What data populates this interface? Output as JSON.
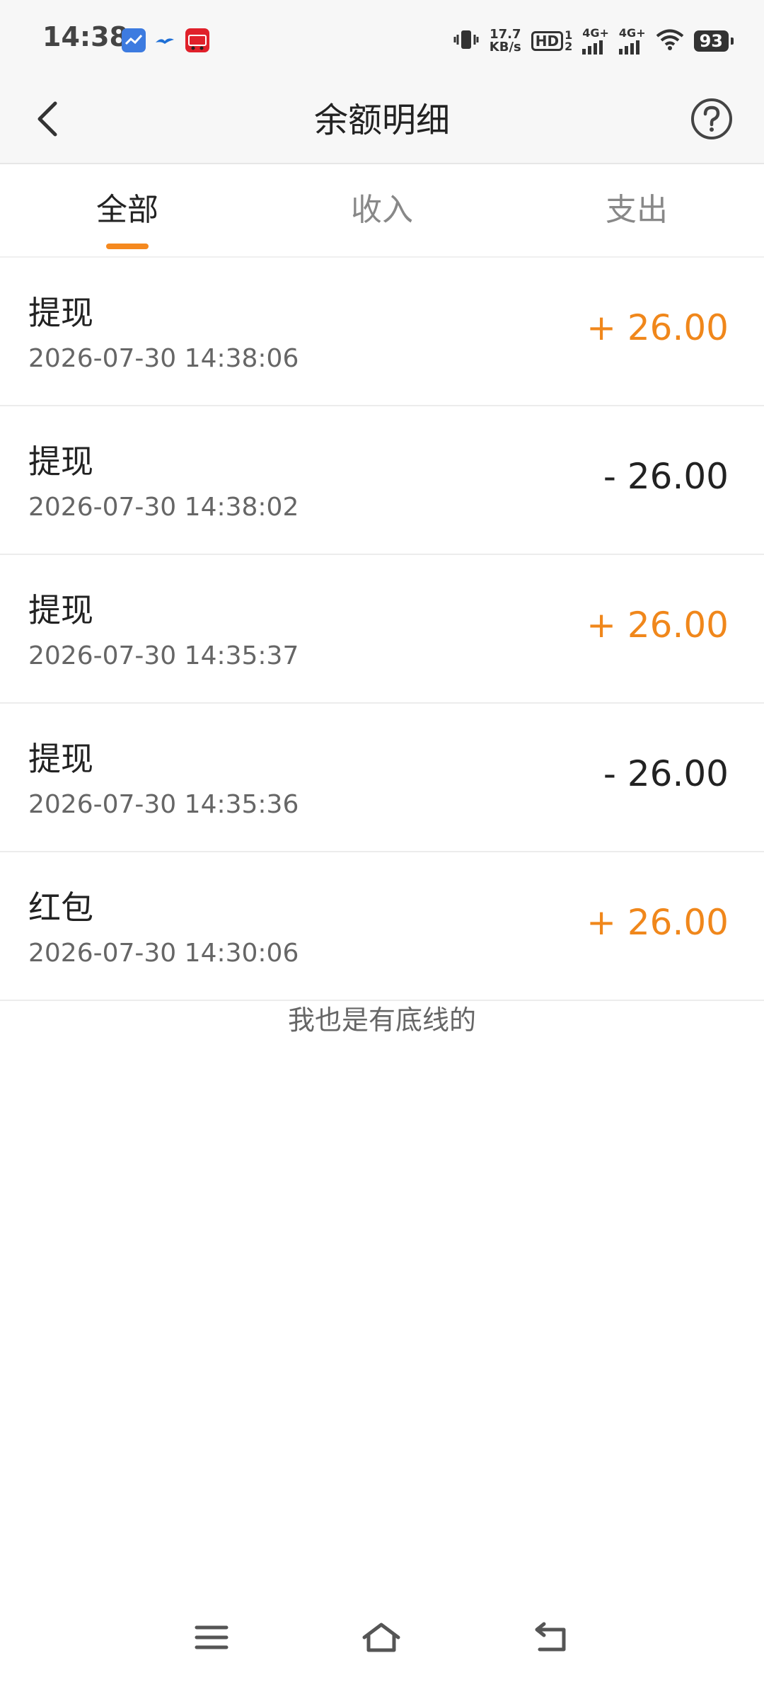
{
  "status_bar": {
    "time": "14:38",
    "net_speed_value": "17.7",
    "net_speed_unit": "KB/s",
    "hd_label": "HD",
    "sim1": "1",
    "sim2": "2",
    "network_1": "4G+",
    "network_2": "4G+",
    "battery": "93"
  },
  "header": {
    "title": "余额明细"
  },
  "tabs": [
    {
      "label": "全部",
      "active": true
    },
    {
      "label": "收入",
      "active": false
    },
    {
      "label": "支出",
      "active": false
    }
  ],
  "transactions": [
    {
      "title": "提现",
      "time": "2026-07-30 14:38:06",
      "amount": "+ 26.00",
      "type": "income"
    },
    {
      "title": "提现",
      "time": "2026-07-30 14:38:02",
      "amount": "- 26.00",
      "type": "expense"
    },
    {
      "title": "提现",
      "time": "2026-07-30 14:35:37",
      "amount": "+ 26.00",
      "type": "income"
    },
    {
      "title": "提现",
      "time": "2026-07-30 14:35:36",
      "amount": "- 26.00",
      "type": "expense"
    },
    {
      "title": "红包",
      "time": "2026-07-30 14:30:06",
      "amount": "+ 26.00",
      "type": "income"
    }
  ],
  "list_end_text": "我也是有底线的",
  "colors": {
    "accent": "#f5891f",
    "income": "#f0871b",
    "expense": "#222222"
  },
  "icons": {
    "back": "chevron-left-icon",
    "help": "question-circle-icon",
    "nav_menu": "menu-icon",
    "nav_home": "home-icon",
    "nav_back": "return-icon"
  }
}
